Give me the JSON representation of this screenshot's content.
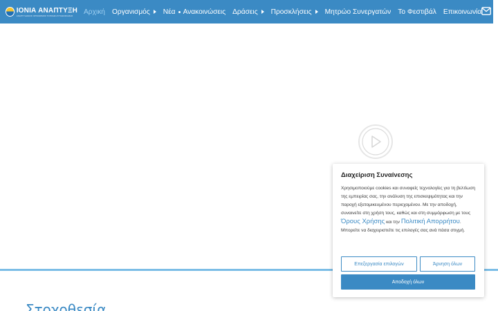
{
  "header": {
    "logo_title": "ΙΟΝΙΑ ΑΝΑΠΤΥΞΗ",
    "logo_subtitle": "ΑΝΑΠΤΥΞΙΑΚΟΣ ΟΡΓΑΝΙΣΜΟΣ ΤΟΠΙΚΗΣ ΑΥΤΟΔΙΟΙΚΗΣΗΣ",
    "nav": [
      {
        "label": "Αρχική",
        "active": true
      },
      {
        "label": "Οργανισμός"
      },
      {
        "label": "Νέα",
        "label2": "Ανακοινώσεις"
      },
      {
        "label": "Δράσεις"
      },
      {
        "label": "Προσκλήσεις"
      },
      {
        "label": "Μητρώο Συνεργατών"
      },
      {
        "label": "Το Φεστιβάλ"
      },
      {
        "label": "Επικοινωνία"
      }
    ],
    "icons": {
      "mail": "envelope-icon",
      "play": "play-icon"
    }
  },
  "colors": {
    "brand": "#3b8ac4",
    "active_nav": "#9fd0f2"
  },
  "main": {
    "section_title": "Στοχοθεσία"
  },
  "cookie": {
    "title": "Διαχείριση Συναίνεσης",
    "text_1": "Χρησιμοποιούμε cookies και συναφείς τεχνολογίες για τη βελτίωση της εμπειρίας σας, την ανάλυση της επισκεψιμότητας και την παροχή εξατομικευμένου περιεχομένου. Με την αποδοχή, συναινείτε στη χρήση τους, καθώς και στη συμμόρφωση με τους",
    "link_terms": "Όρους Χρήσης",
    "text_2": "και την",
    "link_privacy": "Πολιτική Απορρήτου",
    "text_3": ". Μπορείτε να διαχειριστείτε τις επιλογές σας ανά πάσα στιγμή.",
    "btn_edit": "Επεξεργασία επιλογών",
    "btn_reject": "Άρνηση όλων",
    "btn_accept": "Αποδοχή όλων"
  }
}
